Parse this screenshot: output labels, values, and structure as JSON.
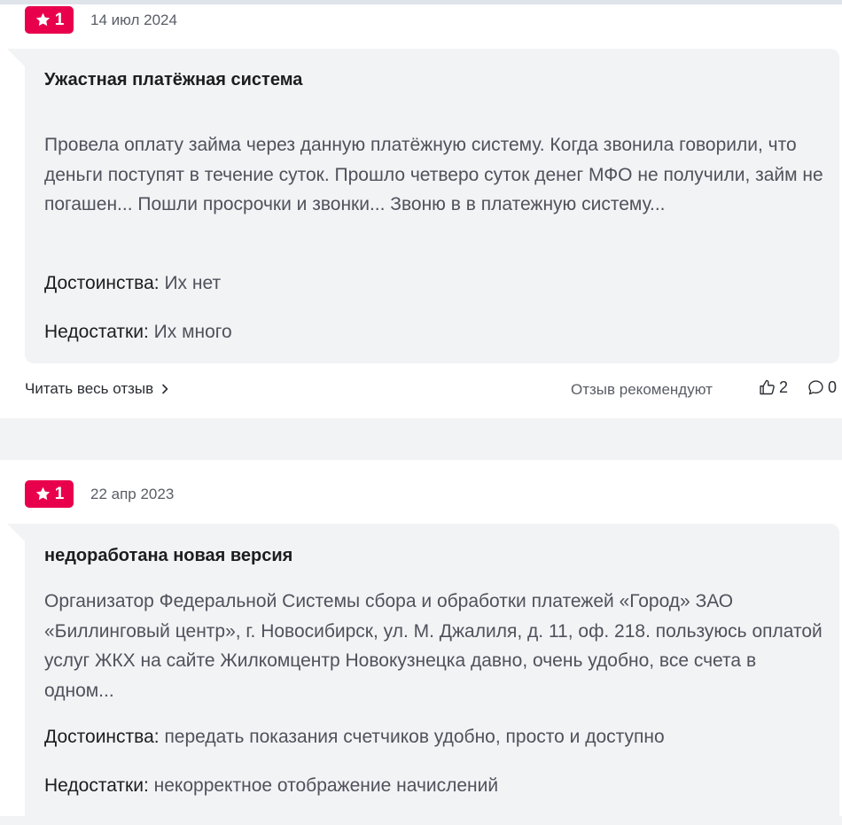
{
  "colors": {
    "rating_badge": "#e8004c",
    "bubble_background": "#f2f3f5",
    "page_background": "#f2f3f5"
  },
  "reviews": [
    {
      "rating": "1",
      "date": "14 июл 2024",
      "title": "Ужастная платёжная система",
      "text": "Провела оплату займа через данную платёжную систему. Когда звонила говорили, что деньги поступят в течение суток. Прошло четверо суток денег МФО не получили, займ не погашен... Пошли просрочки и звонки... Звоню в в платежную систему...",
      "pros_label": "Достоинства:",
      "pros": "Их нет",
      "cons_label": "Недостатки:",
      "cons": "Их много",
      "read_more": "Читать весь отзыв",
      "recommend_label": "Отзыв рекомендуют",
      "likes": "2",
      "comments": "0"
    },
    {
      "rating": "1",
      "date": "22 апр 2023",
      "title": "недоработана новая версия",
      "text": "Организатор Федеральной Системы сбора и обработки платежей «Город» ЗАО «Биллинговый центр», г. Новосибирск, ул. М. Джалиля, д. 11, оф. 218. пользуюсь оплатой услуг ЖКХ на сайте Жилкомцентр Новокузнецка давно, очень удобно, все счета в одном...",
      "pros_label": "Достоинства:",
      "pros": "передать показания счетчиков удобно, просто и доступно",
      "cons_label": "Недостатки:",
      "cons": "некорректное отображение начислений"
    }
  ],
  "icons": {
    "rating": "star-icon",
    "read_more": "chevron-right-icon",
    "likes": "thumbs-up-icon",
    "comments": "comment-icon"
  }
}
